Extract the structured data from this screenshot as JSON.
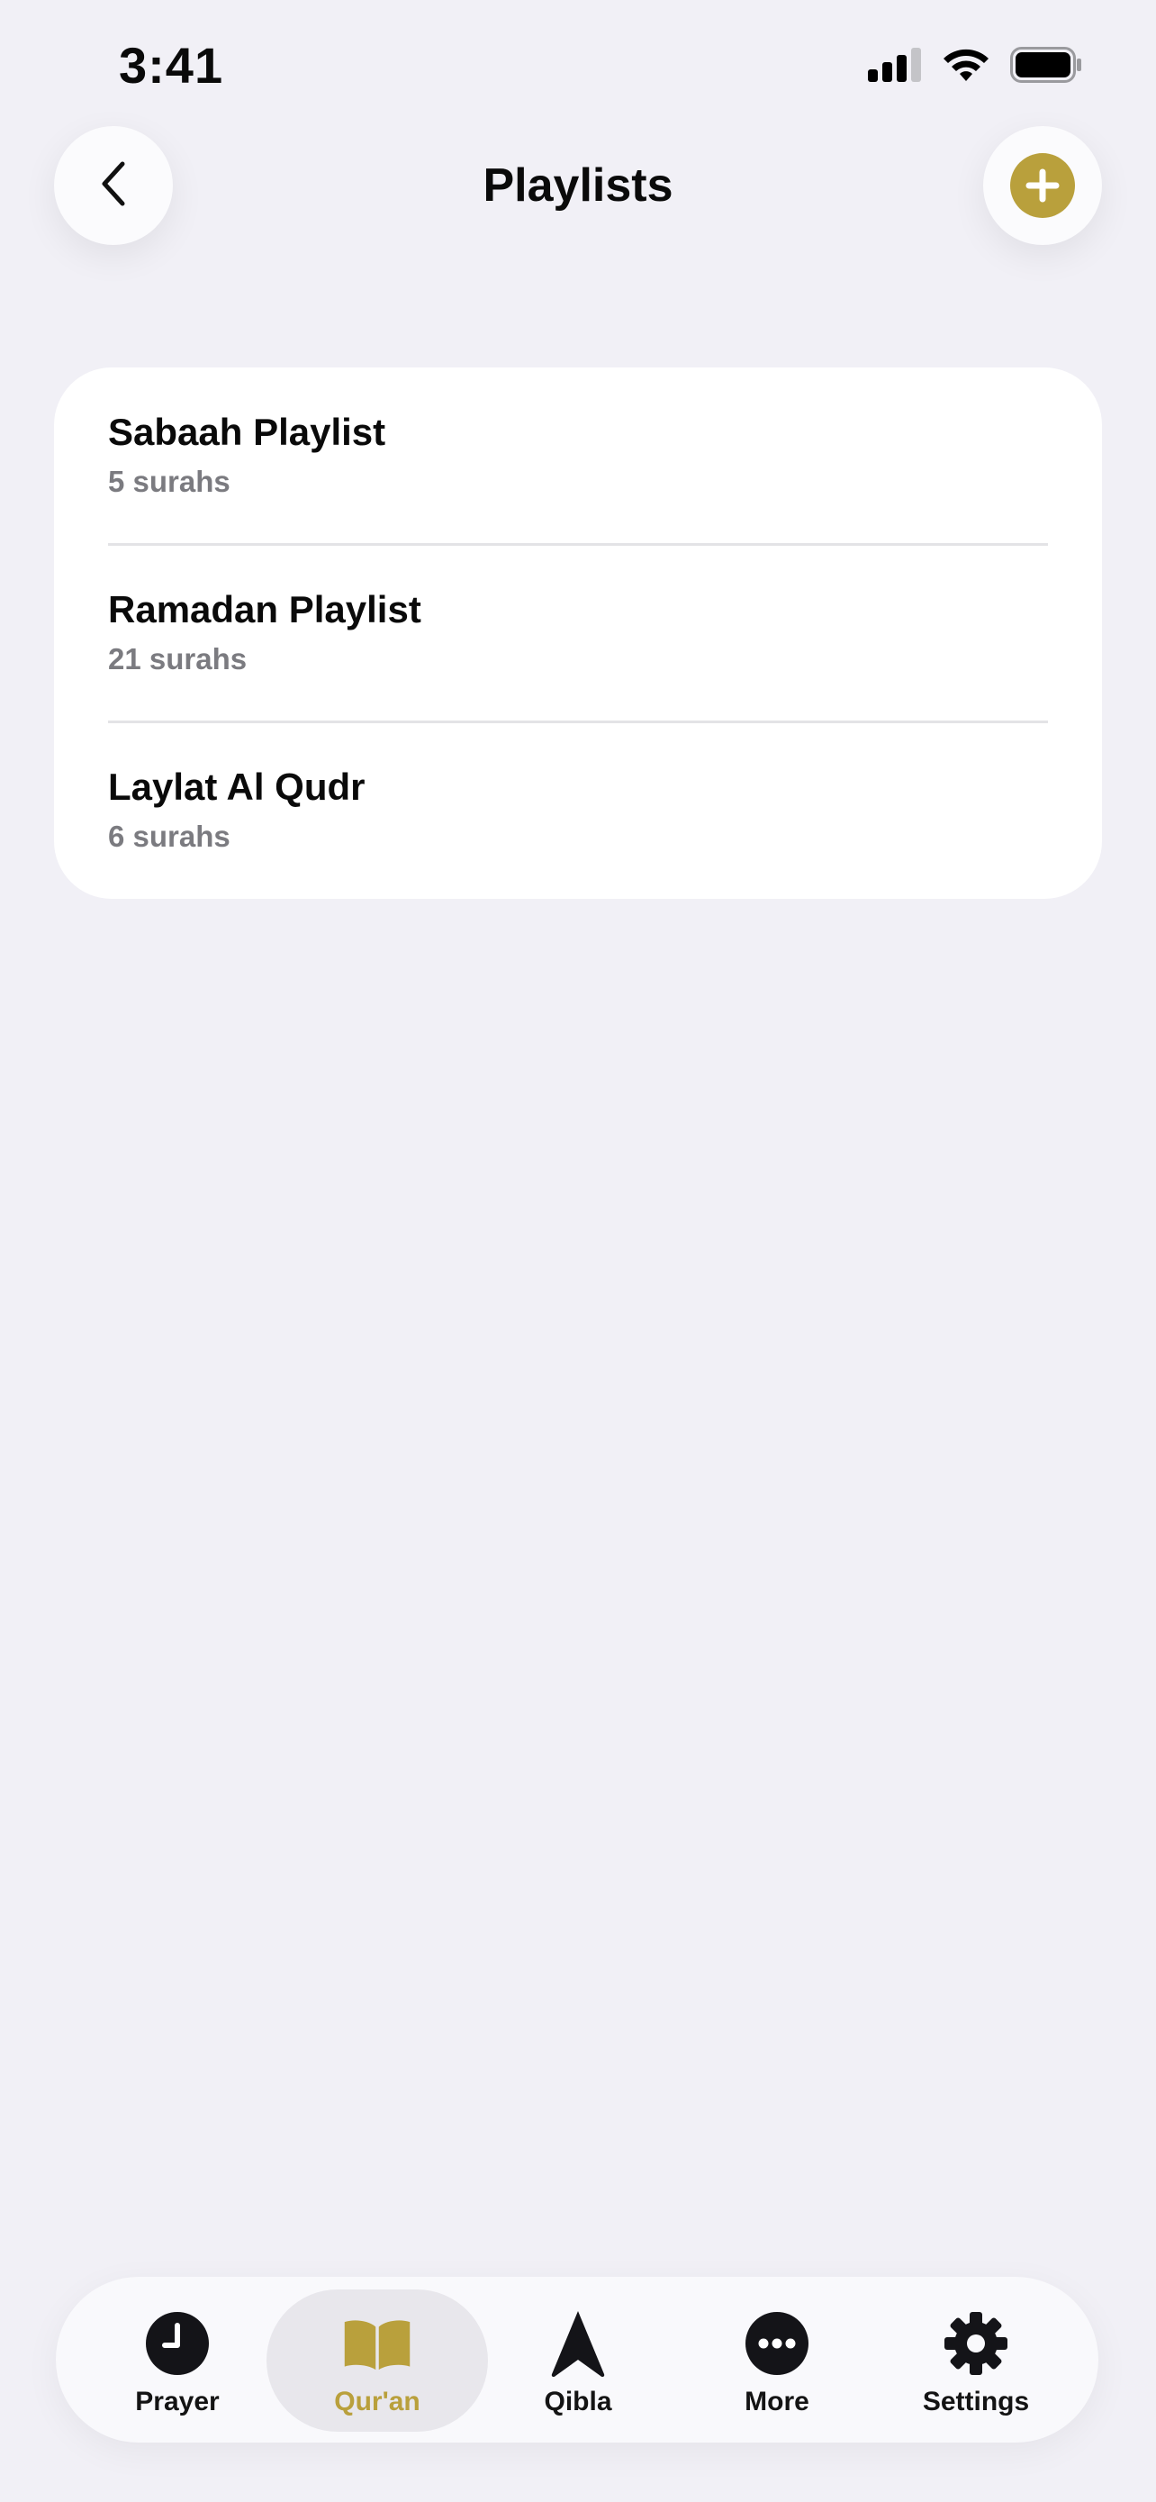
{
  "status_bar": {
    "time": "3:41"
  },
  "header": {
    "title": "Playlists"
  },
  "playlists": [
    {
      "name": "Sabaah Playlist",
      "count": "5 surahs"
    },
    {
      "name": "Ramadan Playlist",
      "count": "21 surahs"
    },
    {
      "name": "Laylat Al Qudr",
      "count": "6 surahs"
    }
  ],
  "tab_bar": {
    "selected": "Qur'an",
    "tabs": [
      {
        "label": "Prayer",
        "icon": "clock-icon"
      },
      {
        "label": "Qur'an",
        "icon": "book-icon"
      },
      {
        "label": "Qibla",
        "icon": "compass-arrow-icon"
      },
      {
        "label": "More",
        "icon": "ellipsis-circle-icon"
      },
      {
        "label": "Settings",
        "icon": "gear-icon"
      }
    ]
  },
  "colors": {
    "accent": "#b9a03c",
    "background": "#f1f0f6",
    "card": "#ffffff",
    "secondary_text": "#7b7b80"
  }
}
